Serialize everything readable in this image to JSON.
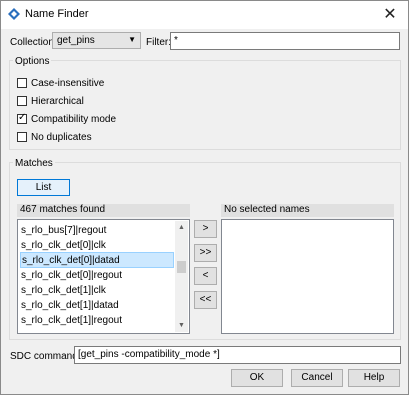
{
  "window": {
    "title": "Name Finder",
    "close_glyph": "✕",
    "icon": "quartus-app-icon"
  },
  "collection": {
    "label": "Collection:",
    "value": "get_pins"
  },
  "filter": {
    "label": "Filter:",
    "value": "*"
  },
  "options": {
    "title": "Options",
    "items": [
      {
        "label": "Case-insensitive",
        "checked": false
      },
      {
        "label": "Hierarchical",
        "checked": false
      },
      {
        "label": "Compatibility mode",
        "checked": true
      },
      {
        "label": "No duplicates",
        "checked": false
      }
    ]
  },
  "matches": {
    "title": "Matches",
    "list_button": "List",
    "found_header": "467 matches found",
    "selected_header": "No selected names",
    "rows": [
      "s_rlo_bus[7]|regout",
      "s_rlo_clk_det[0]|clk",
      "s_rlo_clk_det[0]|datad",
      "s_rlo_clk_det[0]|regout",
      "s_rlo_clk_det[1]|clk",
      "s_rlo_clk_det[1]|datad",
      "s_rlo_clk_det[1]|regout"
    ],
    "selected_row": 2,
    "move_buttons": {
      "add": ">",
      "add_all": ">>",
      "remove": "<",
      "remove_all": "<<"
    }
  },
  "sdc": {
    "label": "SDC command:",
    "value": "[get_pins -compatibility_mode *]"
  },
  "footer": {
    "ok": "OK",
    "cancel": "Cancel",
    "help": "Help"
  },
  "colors": {
    "accent": "#0078d7",
    "selection": "#cce8ff"
  }
}
